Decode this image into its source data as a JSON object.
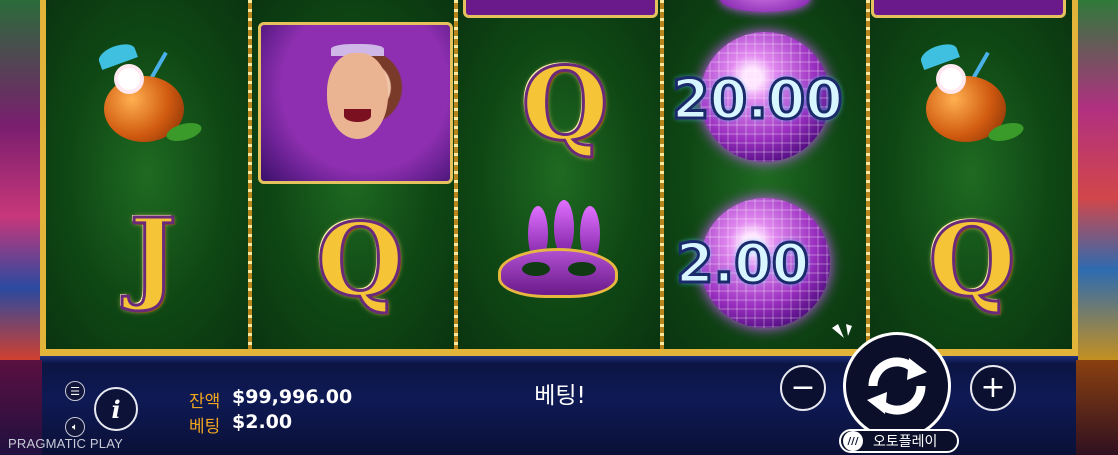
{
  "colors": {
    "frame_gold": "#e3b43a",
    "reel_green": "#0f4714",
    "label_orange": "#f0a51e",
    "bar_blue": "#0f1a55"
  },
  "reels": [
    {
      "symbols": [
        "coconut-drink",
        "J"
      ]
    },
    {
      "symbols": [
        "dancer-portrait",
        "Q"
      ]
    },
    {
      "symbols": [
        "dancer-portrait-partial",
        "Q",
        "masquerade-mask"
      ]
    },
    {
      "symbols": [
        "disco-ball-partial",
        "disco-ball",
        "disco-ball"
      ],
      "values": [
        "20.00",
        "2.00"
      ]
    },
    {
      "symbols": [
        "dancer-portrait-partial",
        "coconut-drink",
        "Q"
      ]
    }
  ],
  "letters": {
    "j": "J",
    "q": "Q"
  },
  "disco_values": {
    "top": "20.00",
    "bottom": "2.00"
  },
  "footer": {
    "brand": "PRAGMATIC PLAY",
    "balance_label": "잔액",
    "balance_value": "$99,996.00",
    "bet_label": "베팅",
    "bet_value": "$2.00",
    "status": "베팅!",
    "autoplay_label": "오토플레이",
    "autoplay_icon_text": "///"
  },
  "icons": [
    "menu-icon",
    "sound-icon",
    "info-icon",
    "minus-icon",
    "spin-icon",
    "plus-icon",
    "autoplay-icon"
  ]
}
